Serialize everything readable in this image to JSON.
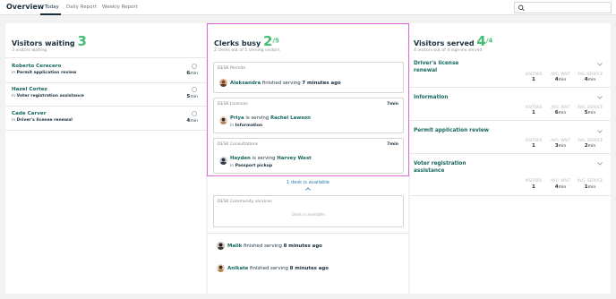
{
  "header": {
    "title": "Overview",
    "tabs": [
      {
        "label": "Today",
        "active": true
      },
      {
        "label": "Daily Report",
        "active": false
      },
      {
        "label": "Weekly Report",
        "active": false
      }
    ],
    "search_placeholder": ""
  },
  "waiting": {
    "title": "Visitors waiting",
    "count": "3",
    "subtitle": "3 visitors waiting",
    "visitors": [
      {
        "name": "Roberto Cerecero",
        "prefix": "in",
        "service": "Permit application review",
        "wait_value": "6",
        "wait_unit": "min"
      },
      {
        "name": "Hazel Cortez",
        "prefix": "in",
        "service": "Voter registration assistance",
        "wait_value": "5",
        "wait_unit": "min"
      },
      {
        "name": "Cade Carver",
        "prefix": "in",
        "service": "Driver's license renewal",
        "wait_value": "4",
        "wait_unit": "min"
      }
    ]
  },
  "clerks": {
    "title": "Clerks busy",
    "busy": "2",
    "total": "/5",
    "subtitle": "2 clerks out of 5 serving visitors",
    "desks": [
      {
        "label": "DESK Permits",
        "time": "",
        "clerk": "Aleksandra",
        "action": "finished serving",
        "after": "7 minutes ago",
        "in_prefix": "",
        "service": ""
      },
      {
        "label": "DESK Licences",
        "time": "7min",
        "clerk": "Priya",
        "action": "is serving",
        "after": "Rachel Lawson",
        "in_prefix": "in",
        "service": "Information"
      },
      {
        "label": "DESK Consultations",
        "time": "7min",
        "clerk": "Hayden",
        "action": "is serving",
        "after": "Harvey West",
        "in_prefix": "in",
        "service": "Passport pickup"
      }
    ],
    "available_text": "1 desk is available",
    "community": {
      "label": "DESK Community services",
      "empty": "Desk is available"
    },
    "recent": [
      {
        "clerk": "Malik",
        "action": "finished serving",
        "when": "8 minutes ago"
      },
      {
        "clerk": "Anikate",
        "action": "finished serving",
        "when": "8 minutes ago"
      }
    ]
  },
  "served": {
    "title": "Visitors served",
    "count": "4",
    "total": "/4",
    "subtitle": "4 visitors out of 4 sign-ins served",
    "stat_labels": {
      "visitors": "VISITORS",
      "avg_wait": "AVG. WAIT",
      "avg_service": "AVG. SERVICE"
    },
    "services": [
      {
        "title": "Driver's license renewal",
        "visitors": "1",
        "avg_wait": "4",
        "avg_service": "4",
        "unit": "min"
      },
      {
        "title": "Information",
        "visitors": "1",
        "avg_wait": "6",
        "avg_service": "5",
        "unit": "min"
      },
      {
        "title": "Permit application review",
        "visitors": "1",
        "avg_wait": "3",
        "avg_service": "2",
        "unit": "min"
      },
      {
        "title": "Voter registration assistance",
        "visitors": "1",
        "avg_wait": "4",
        "avg_service": "1",
        "unit": "min"
      }
    ]
  },
  "colors": {
    "accent_green": "#46bd74",
    "link_teal": "#15675c",
    "highlight": "#e36ad9",
    "link_blue": "#2a7fb0"
  }
}
